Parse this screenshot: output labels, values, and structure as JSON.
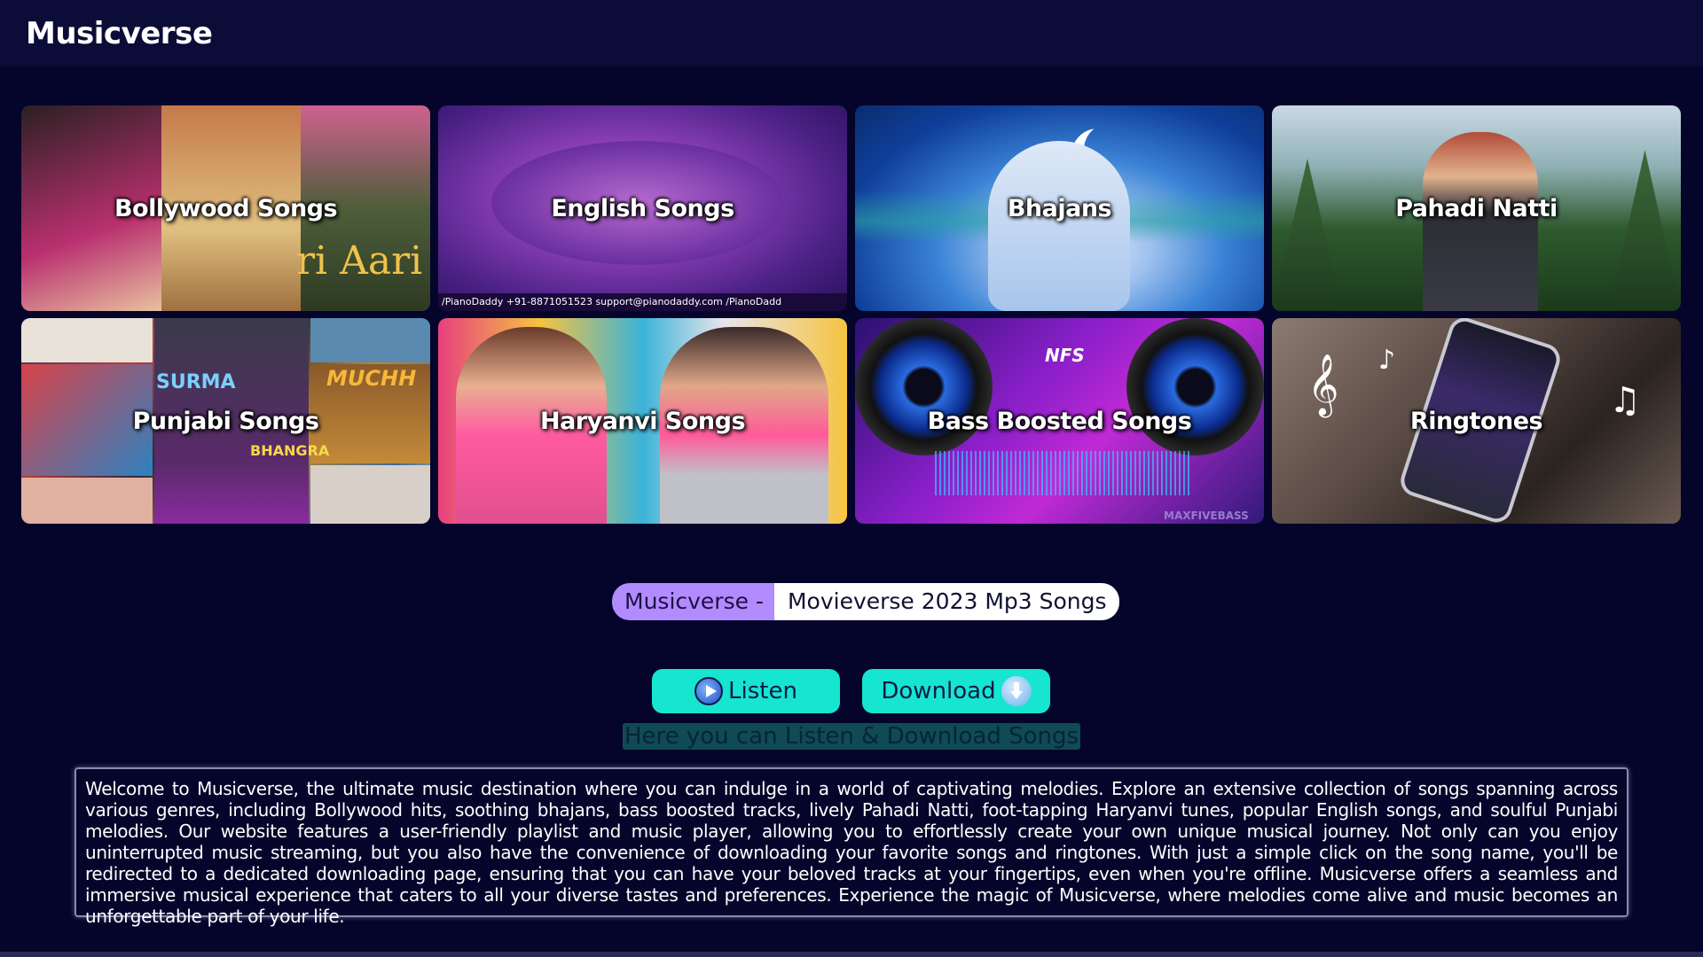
{
  "app": {
    "title": "Musicverse"
  },
  "categories": [
    {
      "label": "Bollywood Songs",
      "icon": "bollywood-cover"
    },
    {
      "label": "English Songs",
      "icon": "english-cover"
    },
    {
      "label": "Bhajans",
      "icon": "bhajans-cover"
    },
    {
      "label": "Pahadi Natti",
      "icon": "pahadi-cover"
    },
    {
      "label": "Punjabi Songs",
      "icon": "punjabi-cover"
    },
    {
      "label": "Haryanvi Songs",
      "icon": "haryanvi-cover"
    },
    {
      "label": "Bass Boosted Songs",
      "icon": "bass-cover"
    },
    {
      "label": "Ringtones",
      "icon": "ringtones-cover"
    }
  ],
  "tile_text": {
    "bollywood_overlay": "ri Aari",
    "english_footer": "/PianoDaddy  +91-8871051523  support@pianodaddy.com  /PianoDadd",
    "punjabi_overlay_1": "SURMA",
    "punjabi_overlay_2": "MUCHH",
    "punjabi_overlay_3": "BHANGRA",
    "bass_overlay": "NFS",
    "bass_footer": "MAXFIVEBASS"
  },
  "tagline": {
    "left": "Musicverse -",
    "right": "Movieverse 2023 Mp3 Songs"
  },
  "actions": {
    "listen": "Listen",
    "download": "Download"
  },
  "subline": "Here you can Listen & Download Songs",
  "about": "Welcome to Musicverse, the ultimate music destination where you can indulge in a world of captivating melodies. Explore an extensive collection of songs spanning across various genres, including Bollywood hits, soothing bhajans, bass boosted tracks, lively Pahadi Natti, foot-tapping Haryanvi tunes, popular English songs, and soulful Punjabi melodies. Our website features a user-friendly playlist and music player, allowing you to effortlessly create your own unique musical journey. Not only can you enjoy uninterrupted music streaming, but you also have the convenience of downloading your favorite songs and ringtones. With just a simple click on the song name, you'll be redirected to a dedicated downloading page, ensuring that you can have your beloved tracks at your fingertips, even when you're offline. Musicverse offers a seamless and immersive musical experience that caters to all your diverse tastes and preferences. Experience the magic of Musicverse, where melodies come alive and music becomes an unforgettable part of your life.",
  "colors": {
    "background": "#05052b",
    "header": "#0c0c38",
    "accent": "#16e5cf",
    "tagline_left": "#b28bff"
  }
}
